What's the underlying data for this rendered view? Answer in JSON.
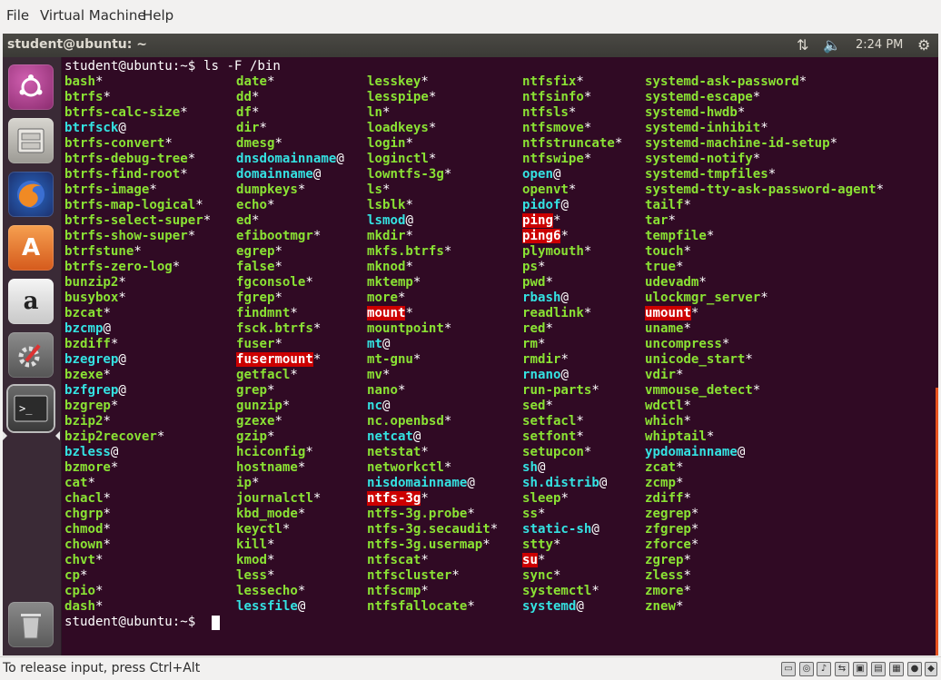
{
  "menubar": {
    "items": [
      "File",
      "Virtual Machine",
      "Help"
    ]
  },
  "topbar": {
    "title": "student@ubuntu: ~",
    "time": "2:24 PM",
    "icons": [
      "network-transfer-icon",
      "volume-icon",
      "power-gear-icon"
    ]
  },
  "launcher": {
    "apps": [
      "ubuntu-dash-icon",
      "files-icon",
      "firefox-icon",
      "software-center-icon",
      "amazon-icon",
      "system-settings-icon",
      "terminal-icon",
      "trash-icon"
    ]
  },
  "terminal": {
    "prompt": "student@ubuntu:~$",
    "command": " ls -F /bin",
    "columns": [
      [
        [
          "bash*",
          "e"
        ],
        [
          "btrfs*",
          "e"
        ],
        [
          "btrfs-calc-size*",
          "e"
        ],
        [
          "btrfsck@",
          "l"
        ],
        [
          "btrfs-convert*",
          "e"
        ],
        [
          "btrfs-debug-tree*",
          "e"
        ],
        [
          "btrfs-find-root*",
          "e"
        ],
        [
          "btrfs-image*",
          "e"
        ],
        [
          "btrfs-map-logical*",
          "e"
        ],
        [
          "btrfs-select-super*",
          "e"
        ],
        [
          "btrfs-show-super*",
          "e"
        ],
        [
          "btrfstune*",
          "e"
        ],
        [
          "btrfs-zero-log*",
          "e"
        ],
        [
          "bunzip2*",
          "e"
        ],
        [
          "busybox*",
          "e"
        ],
        [
          "bzcat*",
          "e"
        ],
        [
          "bzcmp@",
          "l"
        ],
        [
          "bzdiff*",
          "e"
        ],
        [
          "bzegrep@",
          "l"
        ],
        [
          "bzexe*",
          "e"
        ],
        [
          "bzfgrep@",
          "l"
        ],
        [
          "bzgrep*",
          "e"
        ],
        [
          "bzip2*",
          "e"
        ],
        [
          "bzip2recover*",
          "e"
        ],
        [
          "bzless@",
          "l"
        ],
        [
          "bzmore*",
          "e"
        ],
        [
          "cat*",
          "e"
        ],
        [
          "chacl*",
          "e"
        ],
        [
          "chgrp*",
          "e"
        ],
        [
          "chmod*",
          "e"
        ],
        [
          "chown*",
          "e"
        ],
        [
          "chvt*",
          "e"
        ],
        [
          "cp*",
          "e"
        ],
        [
          "cpio*",
          "e"
        ],
        [
          "dash*",
          "e"
        ]
      ],
      [
        [
          "date*",
          "e"
        ],
        [
          "dd*",
          "e"
        ],
        [
          "df*",
          "e"
        ],
        [
          "dir*",
          "e"
        ],
        [
          "dmesg*",
          "e"
        ],
        [
          "dnsdomainname@",
          "l"
        ],
        [
          "domainname@",
          "l"
        ],
        [
          "dumpkeys*",
          "e"
        ],
        [
          "echo*",
          "e"
        ],
        [
          "ed*",
          "e"
        ],
        [
          "efibootmgr*",
          "e"
        ],
        [
          "egrep*",
          "e"
        ],
        [
          "false*",
          "e"
        ],
        [
          "fgconsole*",
          "e"
        ],
        [
          "fgrep*",
          "e"
        ],
        [
          "findmnt*",
          "e"
        ],
        [
          "fsck.btrfs*",
          "e"
        ],
        [
          "fuser*",
          "e"
        ],
        [
          "fusermount*",
          "s"
        ],
        [
          "getfacl*",
          "e"
        ],
        [
          "grep*",
          "e"
        ],
        [
          "gunzip*",
          "e"
        ],
        [
          "gzexe*",
          "e"
        ],
        [
          "gzip*",
          "e"
        ],
        [
          "hciconfig*",
          "e"
        ],
        [
          "hostname*",
          "e"
        ],
        [
          "ip*",
          "e"
        ],
        [
          "journalctl*",
          "e"
        ],
        [
          "kbd_mode*",
          "e"
        ],
        [
          "keyctl*",
          "e"
        ],
        [
          "kill*",
          "e"
        ],
        [
          "kmod*",
          "e"
        ],
        [
          "less*",
          "e"
        ],
        [
          "lessecho*",
          "e"
        ],
        [
          "lessfile@",
          "l"
        ]
      ],
      [
        [
          "lesskey*",
          "e"
        ],
        [
          "lesspipe*",
          "e"
        ],
        [
          "ln*",
          "e"
        ],
        [
          "loadkeys*",
          "e"
        ],
        [
          "login*",
          "e"
        ],
        [
          "loginctl*",
          "e"
        ],
        [
          "lowntfs-3g*",
          "e"
        ],
        [
          "ls*",
          "e"
        ],
        [
          "lsblk*",
          "e"
        ],
        [
          "lsmod@",
          "l"
        ],
        [
          "mkdir*",
          "e"
        ],
        [
          "mkfs.btrfs*",
          "e"
        ],
        [
          "mknod*",
          "e"
        ],
        [
          "mktemp*",
          "e"
        ],
        [
          "more*",
          "e"
        ],
        [
          "mount*",
          "s"
        ],
        [
          "mountpoint*",
          "e"
        ],
        [
          "mt@",
          "l"
        ],
        [
          "mt-gnu*",
          "e"
        ],
        [
          "mv*",
          "e"
        ],
        [
          "nano*",
          "e"
        ],
        [
          "nc@",
          "l"
        ],
        [
          "nc.openbsd*",
          "e"
        ],
        [
          "netcat@",
          "l"
        ],
        [
          "netstat*",
          "e"
        ],
        [
          "networkctl*",
          "e"
        ],
        [
          "nisdomainname@",
          "l"
        ],
        [
          "ntfs-3g*",
          "s"
        ],
        [
          "ntfs-3g.probe*",
          "e"
        ],
        [
          "ntfs-3g.secaudit*",
          "e"
        ],
        [
          "ntfs-3g.usermap*",
          "e"
        ],
        [
          "ntfscat*",
          "e"
        ],
        [
          "ntfscluster*",
          "e"
        ],
        [
          "ntfscmp*",
          "e"
        ],
        [
          "ntfsfallocate*",
          "e"
        ]
      ],
      [
        [
          "ntfsfix*",
          "e"
        ],
        [
          "ntfsinfo*",
          "e"
        ],
        [
          "ntfsls*",
          "e"
        ],
        [
          "ntfsmove*",
          "e"
        ],
        [
          "ntfstruncate*",
          "e"
        ],
        [
          "ntfswipe*",
          "e"
        ],
        [
          "open@",
          "l"
        ],
        [
          "openvt*",
          "e"
        ],
        [
          "pidof@",
          "l"
        ],
        [
          "ping*",
          "s"
        ],
        [
          "ping6*",
          "s"
        ],
        [
          "plymouth*",
          "e"
        ],
        [
          "ps*",
          "e"
        ],
        [
          "pwd*",
          "e"
        ],
        [
          "rbash@",
          "l"
        ],
        [
          "readlink*",
          "e"
        ],
        [
          "red*",
          "e"
        ],
        [
          "rm*",
          "e"
        ],
        [
          "rmdir*",
          "e"
        ],
        [
          "rnano@",
          "l"
        ],
        [
          "run-parts*",
          "e"
        ],
        [
          "sed*",
          "e"
        ],
        [
          "setfacl*",
          "e"
        ],
        [
          "setfont*",
          "e"
        ],
        [
          "setupcon*",
          "e"
        ],
        [
          "sh@",
          "l"
        ],
        [
          "sh.distrib@",
          "l"
        ],
        [
          "sleep*",
          "e"
        ],
        [
          "ss*",
          "e"
        ],
        [
          "static-sh@",
          "l"
        ],
        [
          "stty*",
          "e"
        ],
        [
          "su*",
          "s"
        ],
        [
          "sync*",
          "e"
        ],
        [
          "systemctl*",
          "e"
        ],
        [
          "systemd@",
          "l"
        ]
      ],
      [
        [
          "systemd-ask-password*",
          "e"
        ],
        [
          "systemd-escape*",
          "e"
        ],
        [
          "systemd-hwdb*",
          "e"
        ],
        [
          "systemd-inhibit*",
          "e"
        ],
        [
          "systemd-machine-id-setup*",
          "e"
        ],
        [
          "systemd-notify*",
          "e"
        ],
        [
          "systemd-tmpfiles*",
          "e"
        ],
        [
          "systemd-tty-ask-password-agent*",
          "e"
        ],
        [
          "tailf*",
          "e"
        ],
        [
          "tar*",
          "e"
        ],
        [
          "tempfile*",
          "e"
        ],
        [
          "touch*",
          "e"
        ],
        [
          "true*",
          "e"
        ],
        [
          "udevadm*",
          "e"
        ],
        [
          "ulockmgr_server*",
          "e"
        ],
        [
          "umount*",
          "s"
        ],
        [
          "uname*",
          "e"
        ],
        [
          "uncompress*",
          "e"
        ],
        [
          "unicode_start*",
          "e"
        ],
        [
          "vdir*",
          "e"
        ],
        [
          "vmmouse_detect*",
          "e"
        ],
        [
          "wdctl*",
          "e"
        ],
        [
          "which*",
          "e"
        ],
        [
          "whiptail*",
          "e"
        ],
        [
          "ypdomainname@",
          "l"
        ],
        [
          "zcat*",
          "e"
        ],
        [
          "zcmp*",
          "e"
        ],
        [
          "zdiff*",
          "e"
        ],
        [
          "zegrep*",
          "e"
        ],
        [
          "zfgrep*",
          "e"
        ],
        [
          "zforce*",
          "e"
        ],
        [
          "zgrep*",
          "e"
        ],
        [
          "zless*",
          "e"
        ],
        [
          "zmore*",
          "e"
        ],
        [
          "znew*",
          "e"
        ]
      ]
    ]
  },
  "statusbar": {
    "text": "To release input, press Ctrl+Alt"
  }
}
